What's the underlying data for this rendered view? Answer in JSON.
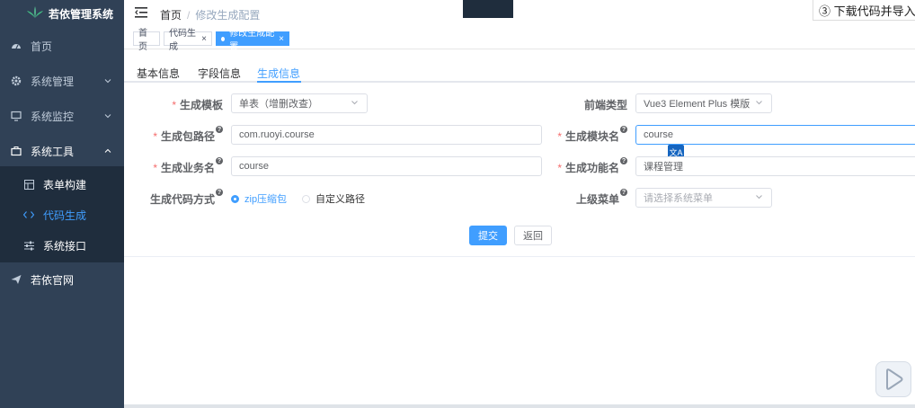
{
  "app": {
    "title": "若依管理系统"
  },
  "sidebar": {
    "items": [
      {
        "label": "首页",
        "icon": "dashboard-icon"
      },
      {
        "label": "系统管理",
        "icon": "gear-icon"
      },
      {
        "label": "系统监控",
        "icon": "monitor-icon"
      },
      {
        "label": "系统工具",
        "icon": "toolbox-icon"
      }
    ],
    "sub_items": [
      {
        "label": "表单构建",
        "icon": "form-icon"
      },
      {
        "label": "代码生成",
        "icon": "code-icon"
      },
      {
        "label": "系统接口",
        "icon": "sliders-icon"
      }
    ],
    "external": {
      "label": "若依官网",
      "icon": "send-icon"
    }
  },
  "navbar": {
    "breadcrumb_home": "首页",
    "breadcrumb_sep": "/",
    "breadcrumb_current": "修改生成配置",
    "step_text": "③  下载代码并导入"
  },
  "tags": {
    "home": "首页",
    "gen": "代码生成",
    "edit": "修改生成配置",
    "close": "×"
  },
  "tabs": [
    "基本信息",
    "字段信息",
    "生成信息"
  ],
  "form": {
    "tpl_label": "生成模板",
    "tpl_value": "单表（增删改查）",
    "front_label": "前端类型",
    "front_value": "Vue3 Element Plus 模版",
    "pkg_label": "生成包路径",
    "pkg_value": "com.ruoyi.course",
    "module_label": "生成模块名",
    "module_value": "course",
    "biz_label": "生成业务名",
    "biz_value": "course",
    "func_label": "生成功能名",
    "func_value": "课程管理",
    "method_label": "生成代码方式",
    "radio_zip": "zip压缩包",
    "radio_custom": "自定义路径",
    "parent_label": "上级菜单",
    "parent_placeholder": "请选择系统菜单",
    "help_glyph": "?"
  },
  "buttons": {
    "submit": "提交",
    "back": "返回"
  },
  "colors": {
    "sidebar": "#304156",
    "submenu": "#1f2d3d",
    "primary": "#409eff",
    "required": "#f56c6c"
  }
}
